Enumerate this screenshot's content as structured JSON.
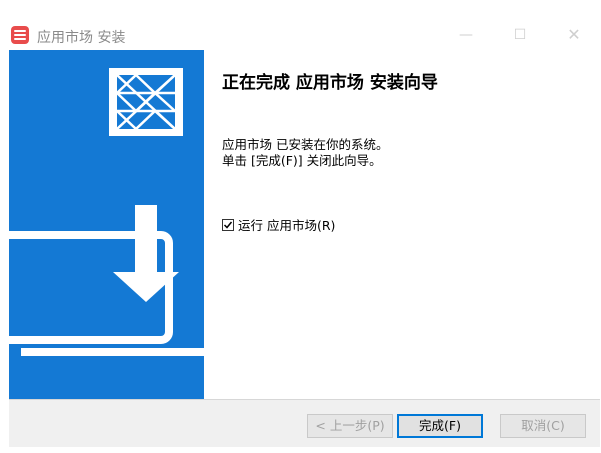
{
  "window": {
    "title": "应用市场 安装",
    "controls": {
      "minimize": "—",
      "maximize": "☐",
      "close": "✕"
    },
    "app_icon": "app-store-icon",
    "accent": "#e84c4c"
  },
  "sidebar": {
    "background": "#1479d4",
    "logo": "installer-logo",
    "illustration": "laptop-download-icon"
  },
  "content": {
    "title": "正在完成 应用市场 安装向导",
    "line1": "应用市场 已安装在你的系统。",
    "line2": "单击 [完成(F)] 关闭此向导。",
    "run_checkbox": {
      "label": "运行 应用市场(R)",
      "checked": true
    }
  },
  "buttons": {
    "back": "< 上一步(P)",
    "finish": "完成(F)",
    "cancel": "取消(C)"
  }
}
